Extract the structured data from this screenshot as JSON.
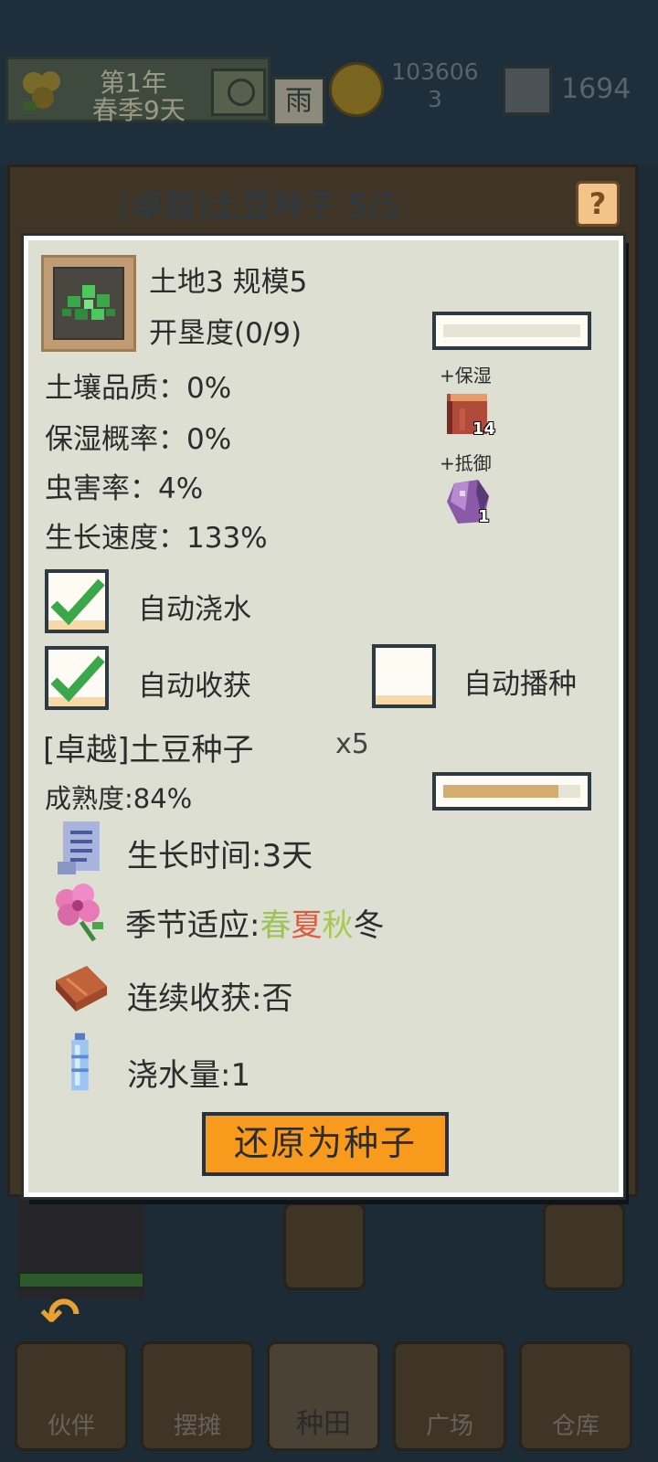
{
  "topbar": {
    "year": "第1年",
    "season_day": "春季9天",
    "weather": "雨",
    "coins_line1": "103606",
    "coins_line2": "3",
    "gems": "1694"
  },
  "background": {
    "header_title": "[卓越]土豆种子 5/5",
    "help_label": "?"
  },
  "panel": {
    "plot_title": "土地3 规模5",
    "reclaim_label": "开垦度(0/9)",
    "reclaim_progress": 0,
    "stats": {
      "soil_quality": "土壤品质：0%",
      "moisture_rate": "保湿概率：0%",
      "pest_rate": "虫害率：4%",
      "growth_speed": "生长速度：133%"
    },
    "items": [
      {
        "label": "+保湿",
        "icon": "moisture-block-icon",
        "count": "14",
        "color": "#b04a3a"
      },
      {
        "label": "+抵御",
        "icon": "defense-crystal-icon",
        "count": "1",
        "color": "#8a5aa8"
      }
    ],
    "toggles": {
      "auto_water": {
        "label": "自动浇水",
        "checked": true
      },
      "auto_harvest": {
        "label": "自动收获",
        "checked": true
      },
      "auto_sow": {
        "label": "自动播种",
        "checked": false
      }
    },
    "crop": {
      "name": "[卓越]土豆种子",
      "qty": "x5",
      "maturity_label": "成熟度:84%",
      "maturity_progress": 0.84,
      "growth_time": "生长时间:3天",
      "season_prefix": "季节适应:",
      "seasons": [
        "春",
        "夏",
        "秋",
        "冬"
      ],
      "continuous_harvest": "连续收获:否",
      "water_amount": "浇水量:1"
    },
    "restore_button": "还原为种子"
  },
  "nav": {
    "items": [
      "伙伴",
      "摆摊",
      "种田",
      "广场",
      "仓库"
    ],
    "active": "种田"
  },
  "colors": {
    "accent_orange": "#f89a1c",
    "check_green": "#3aa84a",
    "panel_bg": "#dcdfd2",
    "spring": "#9ec25a",
    "summer": "#e05a3a",
    "autumn": "#a8c850"
  }
}
